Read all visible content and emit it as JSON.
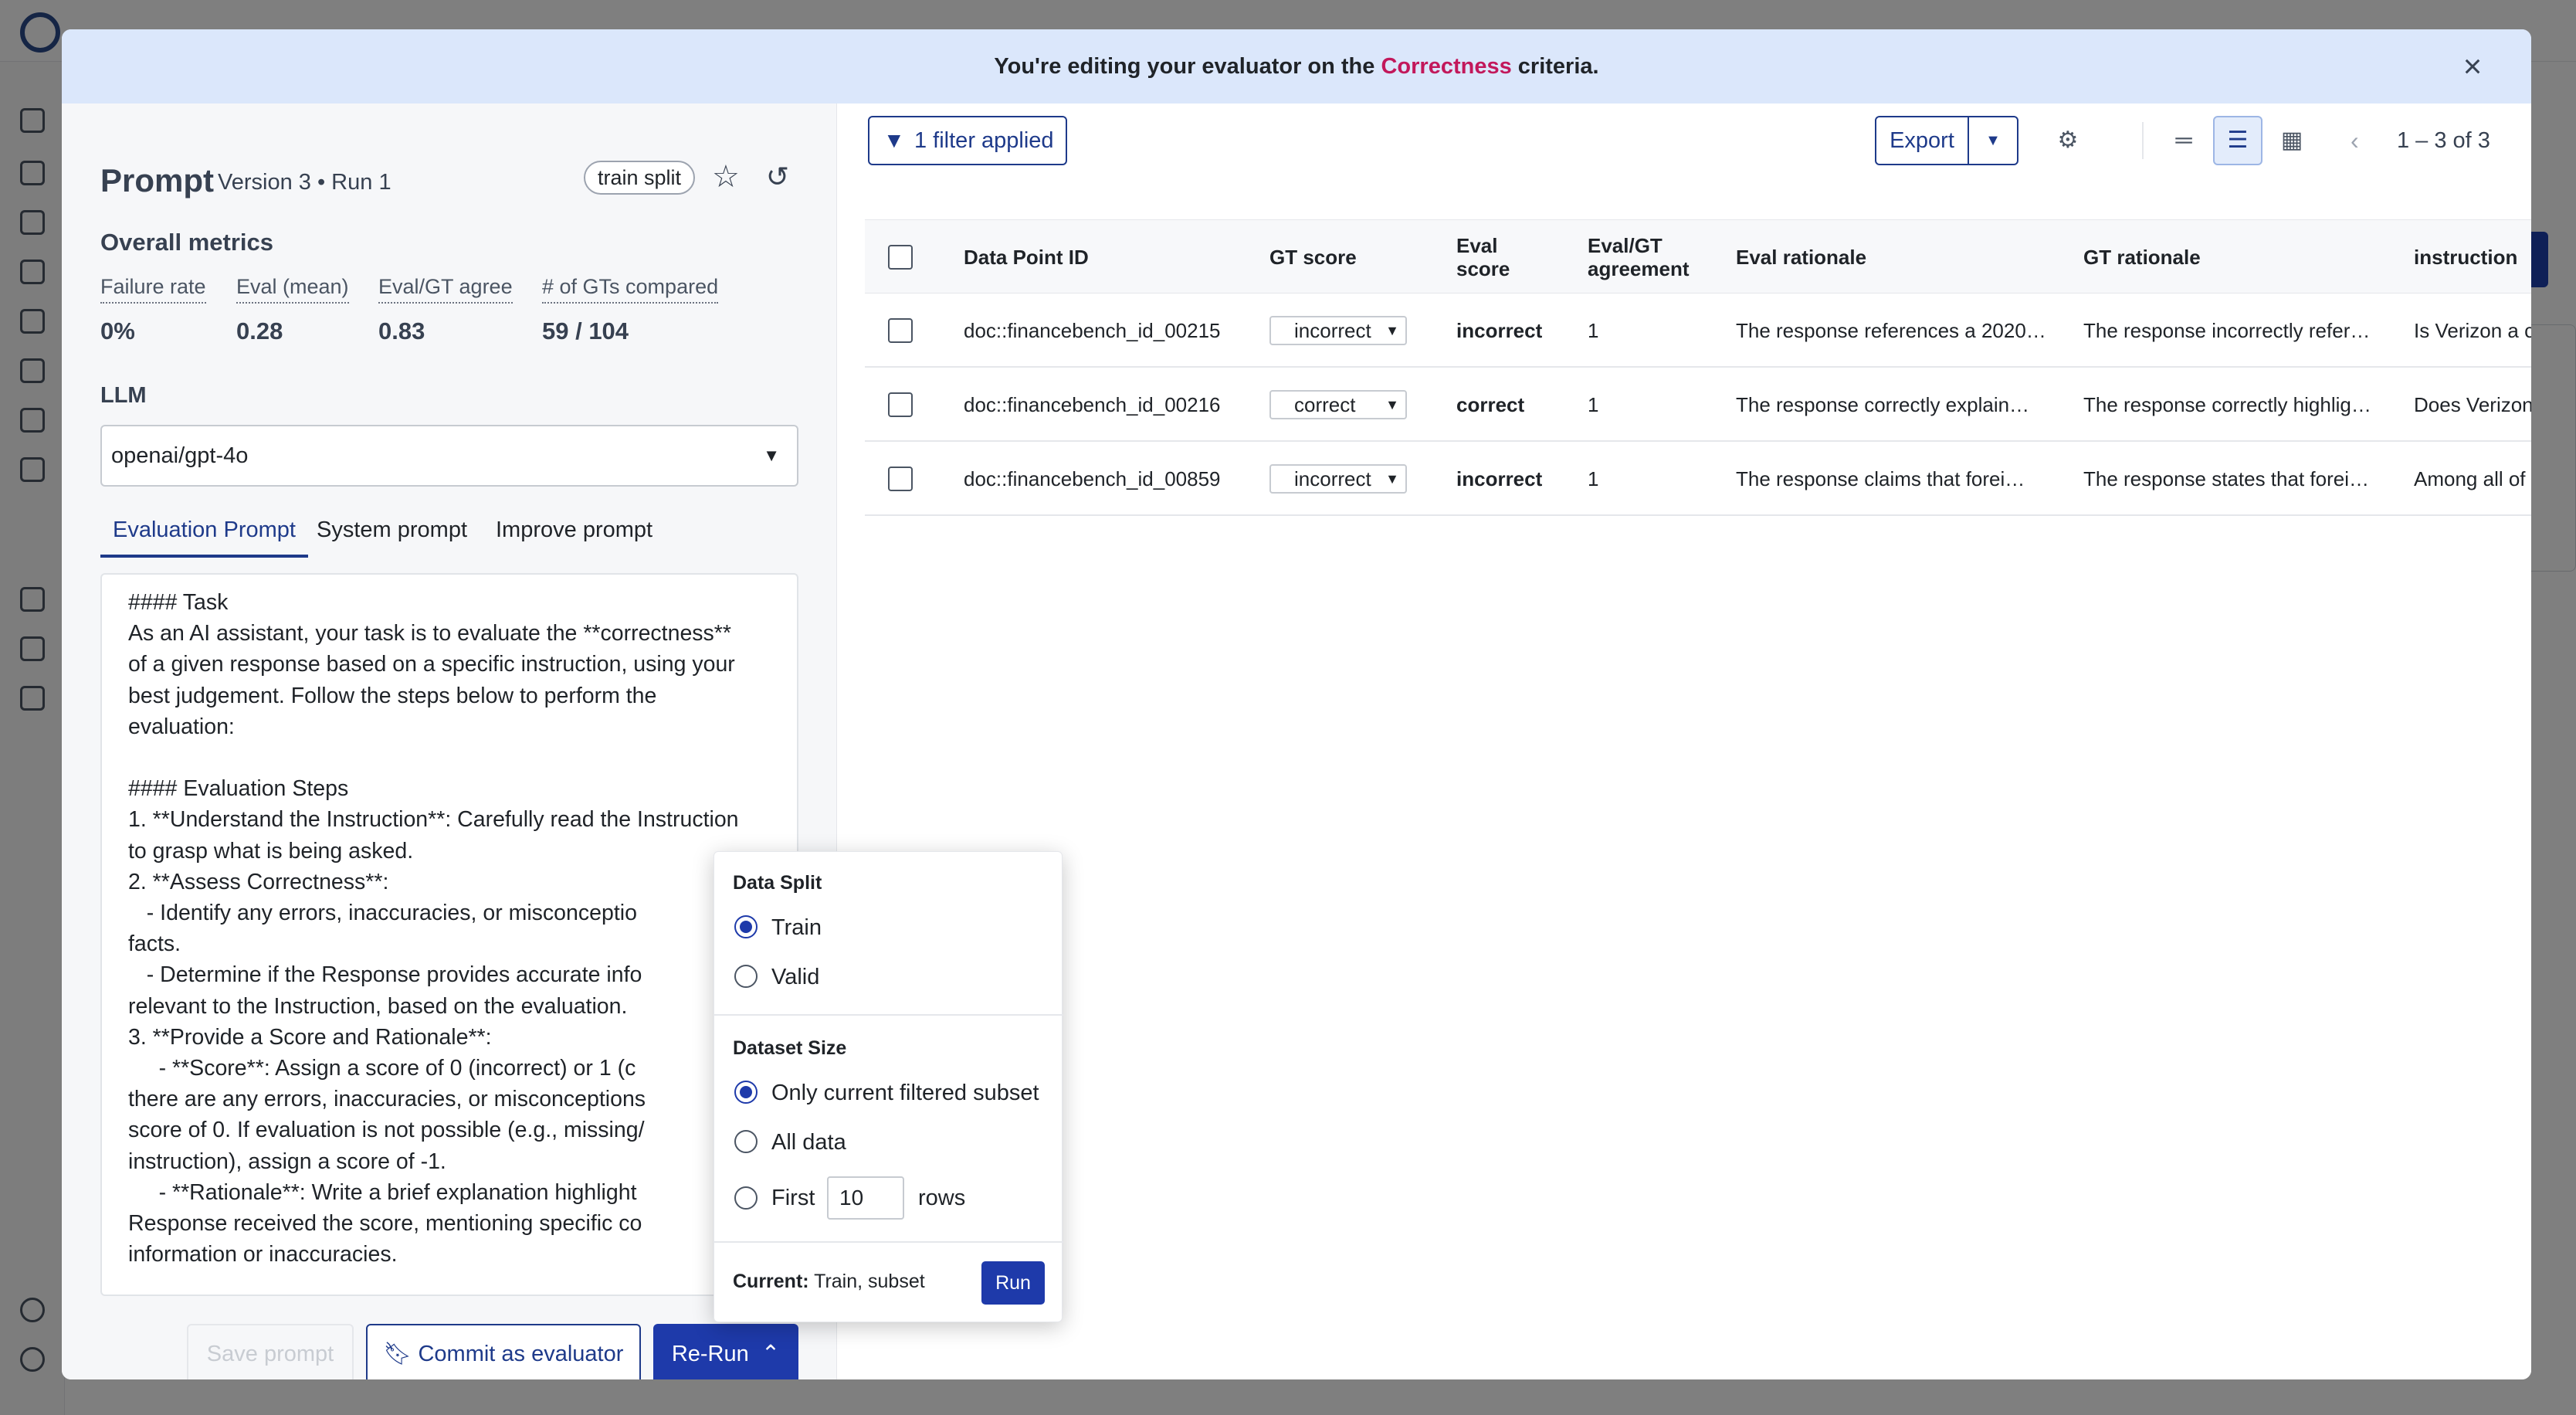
{
  "banner": {
    "prefix": "You're editing your evaluator on the",
    "criteria": "Correctness",
    "suffix": "criteria."
  },
  "prompt": {
    "title": "Prompt",
    "meta": "Version 3 • Run 1",
    "split_pill": "train split"
  },
  "metrics": {
    "heading": "Overall metrics",
    "items": [
      {
        "label": "Failure rate",
        "value": "0%"
      },
      {
        "label": "Eval (mean)",
        "value": "0.28"
      },
      {
        "label": "Eval/GT agree",
        "value": "0.83"
      },
      {
        "label": "# of GTs compared",
        "value": "59 / 104"
      }
    ]
  },
  "llm": {
    "label": "LLM",
    "selected": "openai/gpt-4o"
  },
  "tabs": [
    "Evaluation Prompt",
    "System prompt",
    "Improve prompt"
  ],
  "editor": {
    "text": "#### Task\nAs an AI assistant, your task is to evaluate the **correctness**\nof a given response based on a specific instruction, using your\nbest judgement. Follow the steps below to perform the\nevaluation:\n\n#### Evaluation Steps\n1. **Understand the Instruction**: Carefully read the Instruction\nto grasp what is being asked.\n2. **Assess Correctness**:\n   - Identify any errors, inaccuracies, or misconceptio\nfacts.\n   - Determine if the Response provides accurate info\nrelevant to the Instruction, based on the evaluation.\n3. **Provide a Score and Rationale**:\n     - **Score**: Assign a score of 0 (incorrect) or 1 (c\nthere are any errors, inaccuracies, or misconceptions\nscore of 0. If evaluation is not possible (e.g., missing/\ninstruction), assign a score of -1.\n     - **Rationale**: Write a brief explanation highlight\nResponse received the score, mentioning specific co\ninformation or inaccuracies."
  },
  "buttons": {
    "save": "Save prompt",
    "commit": "Commit as evaluator",
    "rerun": "Re-Run"
  },
  "toolbar": {
    "filter": "1 filter applied",
    "export": "Export",
    "pager": "1 – 3  of  3"
  },
  "table": {
    "headers": [
      "Data Point ID",
      "GT score",
      "Eval\nscore",
      "Eval/GT\nagreement",
      "Eval rationale",
      "GT rationale",
      "instruction"
    ],
    "rows": [
      {
        "id": "doc::financebench_id_00215",
        "gt": "incorrect",
        "eval": "incorrect",
        "agree": "1",
        "eval_rat": "The response references a 2020…",
        "gt_rat": "The response incorrectly refer…",
        "instr": "Is Verizon a ca"
      },
      {
        "id": "doc::financebench_id_00216",
        "gt": "correct",
        "eval": "correct",
        "agree": "1",
        "eval_rat": "The response correctly explain…",
        "gt_rat": "The response correctly highlig…",
        "instr": "Does Verizon"
      },
      {
        "id": "doc::financebench_id_00859",
        "gt": "incorrect",
        "eval": "incorrect",
        "agree": "1",
        "eval_rat": "The response claims that forei…",
        "gt_rat": "The response states that forei…",
        "instr": "Among all of t"
      }
    ]
  },
  "popover": {
    "split_heading": "Data Split",
    "split_options": [
      "Train",
      "Valid"
    ],
    "size_heading": "Dataset Size",
    "size_options": [
      "Only current filtered subset",
      "All data",
      "First"
    ],
    "rows_value": "10",
    "rows_suffix": "rows",
    "current_label": "Current:",
    "current_value": "Train, subset",
    "run": "Run"
  },
  "colors": {
    "accent": "#1e3aaa",
    "criteria": "#c2185b",
    "banner_bg": "#dbe7fb"
  }
}
